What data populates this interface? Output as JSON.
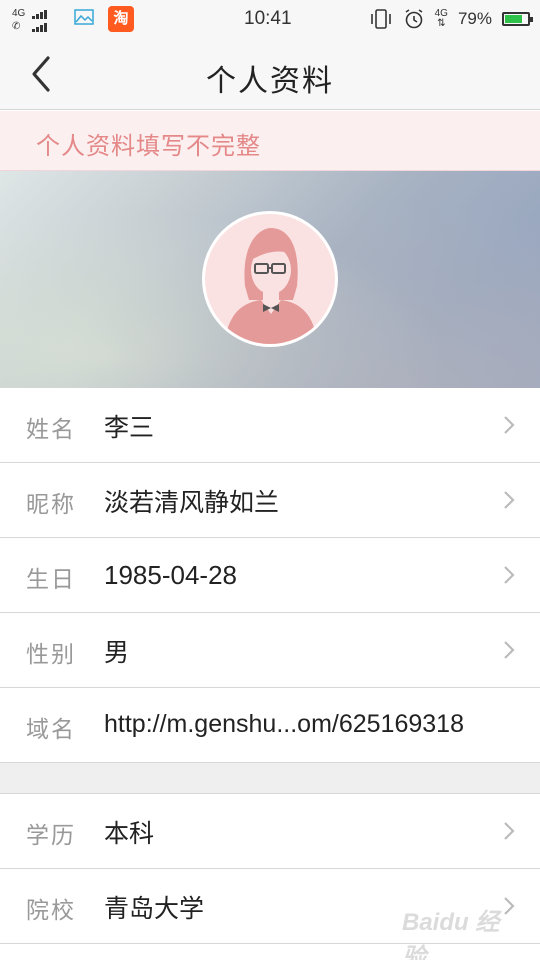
{
  "status_bar": {
    "network_top": "4G",
    "network_bottom": "",
    "time": "10:41",
    "network_right": "4G",
    "battery_percent": "79%",
    "battery_level": 0.79,
    "taobao_icon_text": "淘",
    "colors": {
      "battery_fill": "#2ec24a",
      "taobao": "#ff5a1f"
    }
  },
  "nav": {
    "title": "个人资料",
    "back_icon": "chevron-left-icon"
  },
  "banner": {
    "text": "个人资料填写不完整",
    "color": "#e48888"
  },
  "profile": {
    "avatar_icon": "female-avatar-icon",
    "avatar_color": "#e59a9a"
  },
  "rows": [
    {
      "label": "姓名",
      "value": "李三"
    },
    {
      "label": "昵称",
      "value": "淡若清风静如兰"
    },
    {
      "label": "生日",
      "value": "1985-04-28"
    },
    {
      "label": "性别",
      "value": "男"
    },
    {
      "label": "域名",
      "value": "http://m.genshu...om/625169318"
    }
  ],
  "rows2": [
    {
      "label": "学历",
      "value": "本科"
    },
    {
      "label": "院校",
      "value": "青岛大学"
    }
  ],
  "watermark": {
    "text": "Baidu 经验"
  }
}
